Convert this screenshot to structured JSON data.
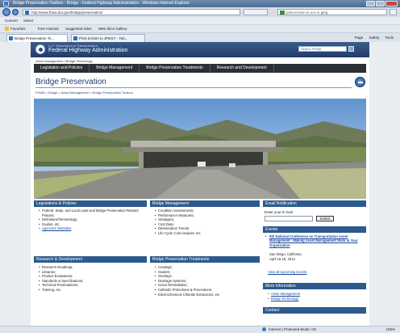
{
  "browser": {
    "window_title": "Bridge Preservation Toolbox - Bridge - Federal Highway Administration - Windows Internet Explorer",
    "address_url": "http://www.fhwa.dot.gov/bridge/preservation/",
    "search_placeholder": "print screen to ocx in jpeg",
    "command_bar": [
      "Convert",
      "Select"
    ],
    "favorites_bar": [
      "Favorites",
      "Free Hotmail",
      "Suggested Sites",
      "Web Slice Gallery"
    ],
    "tabs": [
      "Bridge Preservation To...",
      "Print Screen to JPEG? - Yah..."
    ],
    "tools": [
      "Page",
      "Safety",
      "Tools"
    ],
    "status_zone": "Internet | Protected Mode: On",
    "zoom": "100%"
  },
  "site": {
    "agency_dept": "U.S. Department of Transportation",
    "agency_name": "Federal Highway Administration",
    "search_label": "Search FHWA",
    "crumb_top": "Asset Management | Bridge Technology",
    "nav": [
      "Legislation and Policies",
      "Bridge Management",
      "Bridge Preservation Treatments",
      "Research and Development"
    ],
    "page_title": "Bridge Preservation",
    "breadcrumb": "FHWA > Bridge > Asset Management > Bridge Preservation Toolbox"
  },
  "sections": {
    "legislations": {
      "title": "Legislations & Policies",
      "items": [
        "Federal, State, and Local Laws and Bridge Preservation Related Policies;",
        "Definitions/Terminology;",
        "Guides; etc.",
        "Agencies' Websites"
      ]
    },
    "bridge_management": {
      "title": "Bridge Management",
      "items": [
        "Condition Assessments;",
        "Performance Measures;",
        "Strategies;",
        "Cost Data;",
        "Deterioration Trends;",
        "Life Cycle Cost Analysis; etc."
      ]
    },
    "research": {
      "title": "Research & Development",
      "items": [
        "Research Roadmap;",
        "Libraries;",
        "Product Evaluations;",
        "Standards & Specifications;",
        "Technical Presentations;",
        "Training; etc."
      ]
    },
    "treatments": {
      "title": "Bridge Preservation Treatments",
      "items": [
        "Coatings;",
        "Sealers;",
        "Overlays;",
        "Drainage Systems;",
        "Scour Remediation;",
        "Cathodic Protections & Preventions;",
        "Electrochemical Chloride Extractions; etc."
      ]
    }
  },
  "sidebar": {
    "email": {
      "title": "Email Notification",
      "label": "Enter your E-mail",
      "button": "Submit"
    },
    "events": {
      "title": "Events",
      "event_title": "9th National Conference on Transportation Asset Management - Making Asset Management Work in Your Organization",
      "location": "San Diego, California",
      "dates": "April 16-18, 2012",
      "view_all": "View all Upcoming Events"
    },
    "more": {
      "title": "More Information",
      "items": [
        "Asset Management",
        "Bridge Technology"
      ]
    },
    "contact": {
      "title": "Contact"
    }
  }
}
